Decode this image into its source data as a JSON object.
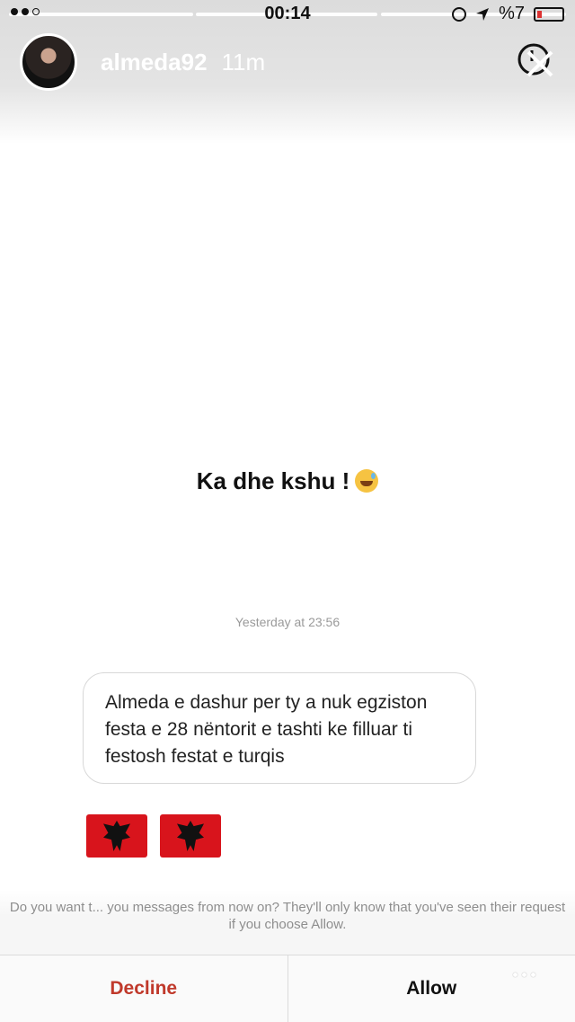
{
  "status_bar": {
    "time": "00:14",
    "battery_text": "%7"
  },
  "story": {
    "username": "almeda92",
    "age": "11m",
    "text": "Ka dhe kshu !",
    "progress_segments": 3
  },
  "message": {
    "timestamp": "Yesterday at 23:56",
    "body": "Almeda e dashur per ty a nuk egziston festa e 28 nëntorit e tashti ke filluar ti festosh festat e turqis",
    "flags": [
      "albania-flag",
      "albania-flag"
    ]
  },
  "request": {
    "prompt": "Do you want t... you messages from now on? They'll only know that you've seen their request if you choose Allow.",
    "decline_label": "Decline",
    "allow_label": "Allow"
  },
  "colors": {
    "decline": "#c0392b",
    "flag_red": "#d8141c"
  }
}
